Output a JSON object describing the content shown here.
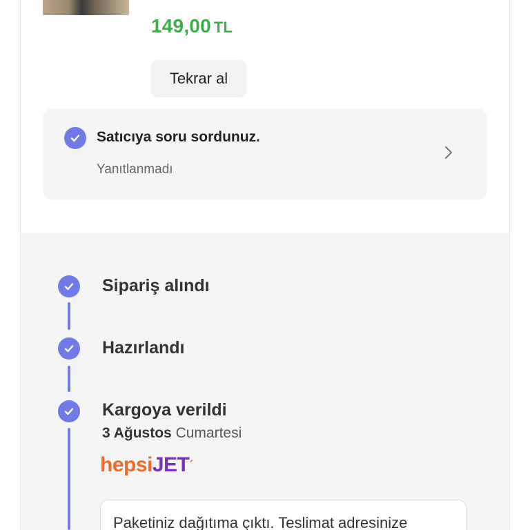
{
  "product": {
    "price_value": "149,00",
    "price_currency": "TL",
    "reorder_label": "Tekrar al"
  },
  "question": {
    "title": "Satıcıya soru sordunuz.",
    "status": "Yanıtlanmadı"
  },
  "timeline": {
    "steps": [
      {
        "label": "Sipariş alındı"
      },
      {
        "label": "Hazırlandı"
      },
      {
        "label": "Kargoya verildi"
      }
    ],
    "shipped_date_bold": "3 Ağustos",
    "shipped_date_day": "Cumartesi",
    "carrier": {
      "part1": "hepsi",
      "part2": "JET",
      "mark": "´"
    },
    "delivery_message": "Paketiniz dağıtıma çıktı. Teslimat adresinize"
  },
  "colors": {
    "accent": "#6f7ce8",
    "price": "#3fae49",
    "card_bg": "#f5f5f5"
  },
  "icons": {
    "check": "check-circle-icon",
    "chevron": "chevron-right-icon"
  }
}
